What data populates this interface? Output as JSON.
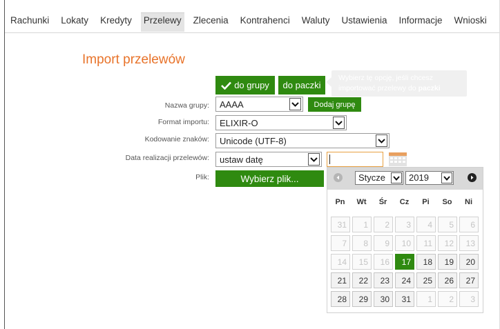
{
  "nav": {
    "items": [
      {
        "label": "Rachunki",
        "active": false
      },
      {
        "label": "Lokaty",
        "active": false
      },
      {
        "label": "Kredyty",
        "active": false
      },
      {
        "label": "Przelewy",
        "active": true
      },
      {
        "label": "Zlecenia",
        "active": false
      },
      {
        "label": "Kontrahenci",
        "active": false
      },
      {
        "label": "Waluty",
        "active": false
      },
      {
        "label": "Ustawienia",
        "active": false
      },
      {
        "label": "Informacje",
        "active": false
      },
      {
        "label": "Wnioski",
        "active": false
      }
    ]
  },
  "page": {
    "title": "Import przelewów"
  },
  "mode": {
    "group_label": "do grupy",
    "pack_label": "do paczki",
    "tooltip_text": "Wybierz tę opcję, jeśli chcesz importować przelewy do",
    "tooltip_bold": "paczki"
  },
  "form": {
    "group_name": {
      "label": "Nazwa grupy:",
      "value": "AAAA",
      "add_label": "Dodaj grupę"
    },
    "format": {
      "label": "Format importu:",
      "value": "ELIXIR-O"
    },
    "encoding": {
      "label": "Kodowanie znaków:",
      "value": "Unicode (UTF-8)"
    },
    "date": {
      "label": "Data realizacji przelewów:",
      "value": "ustaw datę",
      "input_value": ""
    },
    "file": {
      "label": "Plik:",
      "button_label": "Wybierz plik..."
    }
  },
  "calendar": {
    "month": "Stycze",
    "year": "2019",
    "weekdays": [
      "Pn",
      "Wt",
      "Śr",
      "Cz",
      "Pi",
      "So",
      "Ni"
    ],
    "weeks": [
      [
        {
          "d": "31",
          "s": "muted"
        },
        {
          "d": "1",
          "s": "muted"
        },
        {
          "d": "2",
          "s": "muted"
        },
        {
          "d": "3",
          "s": "muted"
        },
        {
          "d": "4",
          "s": "muted"
        },
        {
          "d": "5",
          "s": "muted"
        },
        {
          "d": "6",
          "s": "muted"
        }
      ],
      [
        {
          "d": "7",
          "s": "muted"
        },
        {
          "d": "8",
          "s": "muted"
        },
        {
          "d": "9",
          "s": "muted"
        },
        {
          "d": "10",
          "s": "muted"
        },
        {
          "d": "11",
          "s": "muted"
        },
        {
          "d": "12",
          "s": "muted"
        },
        {
          "d": "13",
          "s": "muted"
        }
      ],
      [
        {
          "d": "14",
          "s": "muted"
        },
        {
          "d": "15",
          "s": "muted"
        },
        {
          "d": "16",
          "s": "muted"
        },
        {
          "d": "17",
          "s": "today"
        },
        {
          "d": "18",
          "s": "active"
        },
        {
          "d": "19",
          "s": "active"
        },
        {
          "d": "20",
          "s": "active"
        }
      ],
      [
        {
          "d": "21",
          "s": "active"
        },
        {
          "d": "22",
          "s": "active"
        },
        {
          "d": "23",
          "s": "active"
        },
        {
          "d": "24",
          "s": "active"
        },
        {
          "d": "25",
          "s": "active"
        },
        {
          "d": "26",
          "s": "active"
        },
        {
          "d": "27",
          "s": "active"
        }
      ],
      [
        {
          "d": "28",
          "s": "active"
        },
        {
          "d": "29",
          "s": "active"
        },
        {
          "d": "30",
          "s": "active"
        },
        {
          "d": "31",
          "s": "active"
        },
        {
          "d": "1",
          "s": "muted"
        },
        {
          "d": "2",
          "s": "muted"
        },
        {
          "d": "3",
          "s": "muted"
        }
      ]
    ]
  },
  "icons": {
    "check": "check-icon",
    "dropdown": "chevron-down-icon",
    "calendar": "calendar-icon",
    "prev": "prev-month-icon",
    "next": "next-month-icon"
  },
  "colors": {
    "accent_green": "#2f8a10",
    "title_orange": "#e8732a",
    "input_focus": "#e8a040"
  }
}
